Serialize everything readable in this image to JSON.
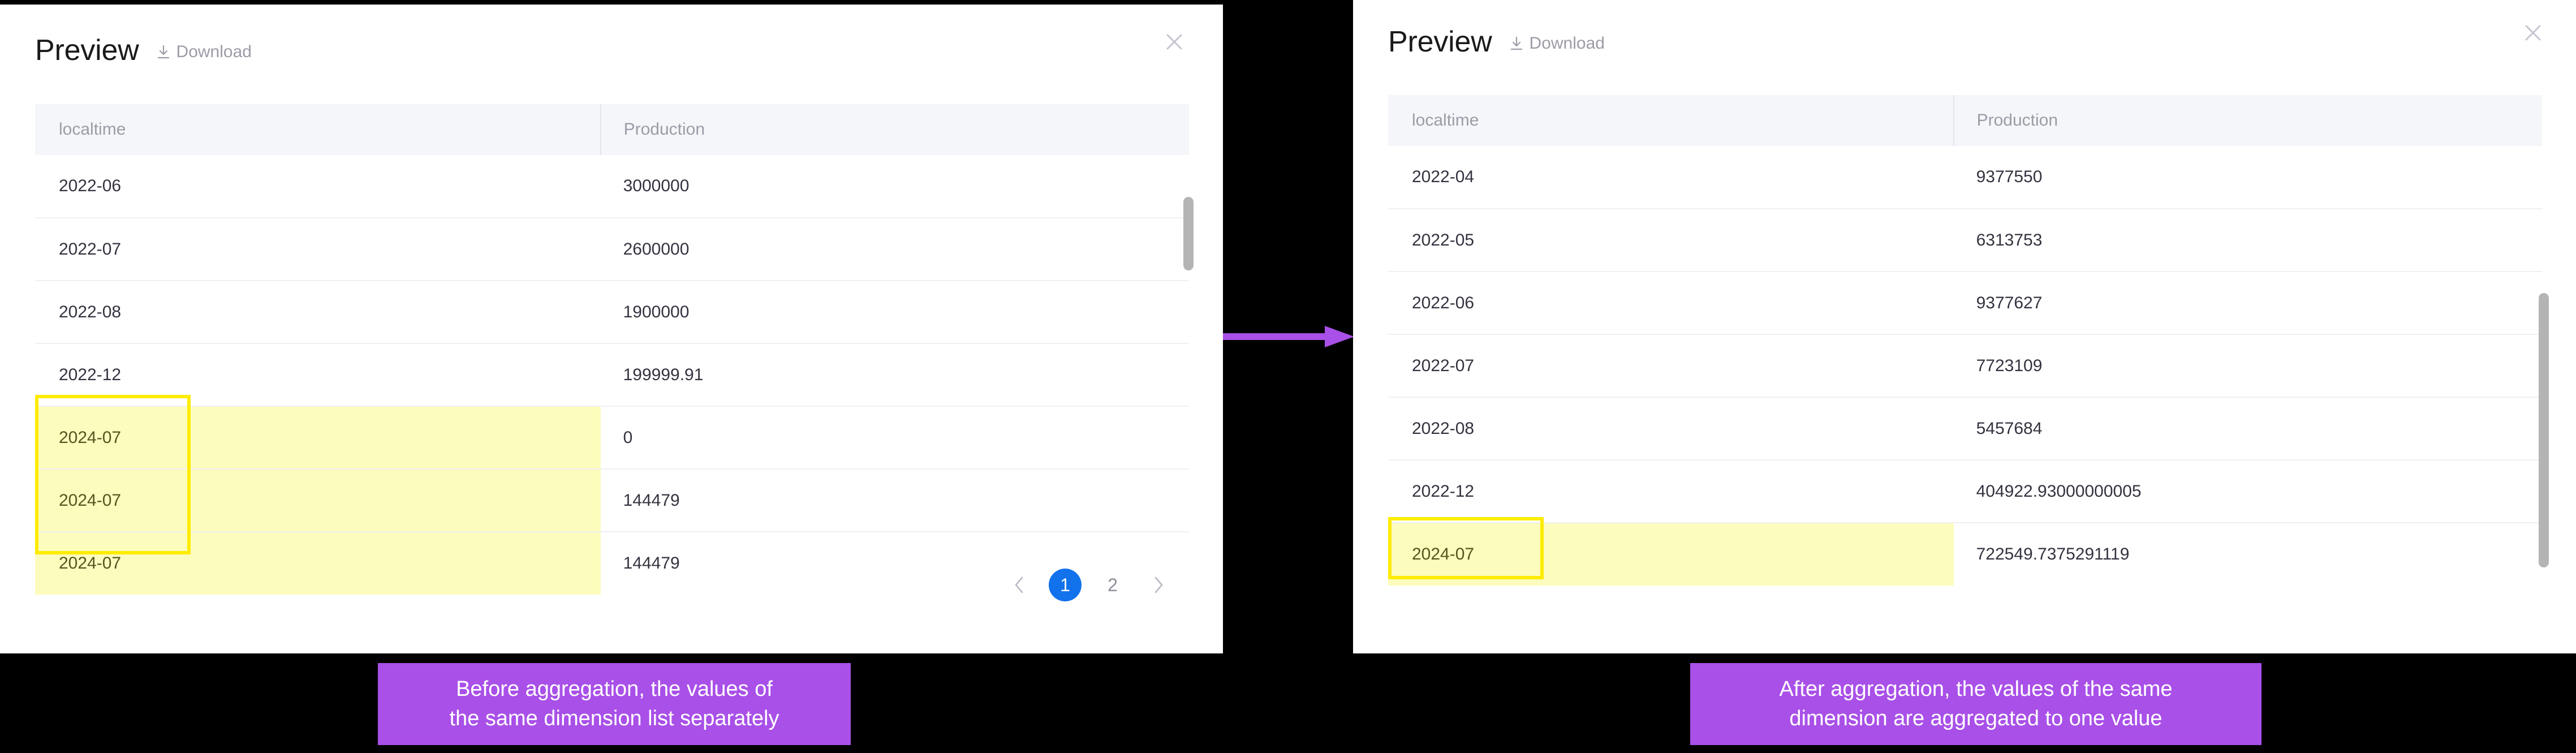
{
  "panels": {
    "left": {
      "title": "Preview",
      "download_label": "Download",
      "download_icon": "download-icon",
      "close_icon": "close-icon",
      "columns": [
        "localtime",
        "Production"
      ],
      "rows": [
        {
          "localtime": "2022-06",
          "production": "3000000",
          "highlight": false
        },
        {
          "localtime": "2022-07",
          "production": "2600000",
          "highlight": false
        },
        {
          "localtime": "2022-08",
          "production": "1900000",
          "highlight": false
        },
        {
          "localtime": "2022-12",
          "production": "199999.91",
          "highlight": false
        },
        {
          "localtime": "2024-07",
          "production": "0",
          "highlight": true
        },
        {
          "localtime": "2024-07",
          "production": "144479",
          "highlight": true
        },
        {
          "localtime": "2024-07",
          "production": "144479",
          "highlight": true
        }
      ],
      "pagination": {
        "prev_icon": "chevron-left-icon",
        "next_icon": "chevron-right-icon",
        "pages": [
          "1",
          "2"
        ],
        "current": "1",
        "active_color": "#1272ec"
      },
      "caption": {
        "line1": "Before aggregation, the values of",
        "line2": "the same dimension list separately"
      }
    },
    "right": {
      "title": "Preview",
      "download_label": "Download",
      "download_icon": "download-icon",
      "close_icon": "close-icon",
      "columns": [
        "localtime",
        "Production"
      ],
      "rows": [
        {
          "localtime": "2022-04",
          "production": "9377550",
          "highlight": false
        },
        {
          "localtime": "2022-05",
          "production": "6313753",
          "highlight": false
        },
        {
          "localtime": "2022-06",
          "production": "9377627",
          "highlight": false
        },
        {
          "localtime": "2022-07",
          "production": "7723109",
          "highlight": false
        },
        {
          "localtime": "2022-08",
          "production": "5457684",
          "highlight": false
        },
        {
          "localtime": "2022-12",
          "production": "404922.93000000005",
          "highlight": false
        },
        {
          "localtime": "2024-07",
          "production": "722549.7375291119",
          "highlight": true
        }
      ],
      "caption": {
        "line1": "After aggregation, the values of the same",
        "line2": "dimension are aggregated to one value"
      }
    }
  },
  "annotation": {
    "arrow_icon": "right-arrow-icon",
    "arrow_color": "#a950e8",
    "highlight_color": "#ffec00",
    "highlight_fill": "#fcfcbd"
  }
}
